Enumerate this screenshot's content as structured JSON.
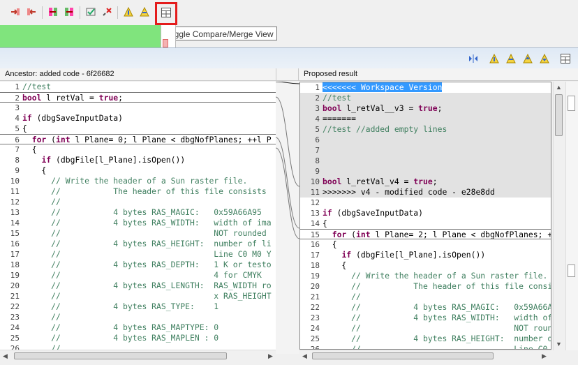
{
  "toolbar": {
    "icons": [
      "copy-all-left-icon",
      "copy-all-right-icon",
      "merge-left-icon",
      "merge-right-icon",
      "accept-icon",
      "reject-icon",
      "next-diff-icon",
      "prev-diff-icon",
      "toggle-compare-view-icon"
    ]
  },
  "tooltip": "Toggle Compare/Merge View",
  "left": {
    "header": "Ancestor: added code - 6f26682",
    "lines": [
      {
        "n": "1",
        "t": "//test"
      },
      {
        "n": "2",
        "t": "bool l_retVal = true;"
      },
      {
        "n": "3",
        "t": ""
      },
      {
        "n": "4",
        "t": "if (dbgSaveInputData)"
      },
      {
        "n": "5",
        "t": "{"
      },
      {
        "n": "6",
        "t": "  for (int l_Plane= 0; l_Plane < dbgNofPlanes; ++l_P"
      },
      {
        "n": "7",
        "t": "  {"
      },
      {
        "n": "8",
        "t": "    if (dbgFile[l_Plane].isOpen())"
      },
      {
        "n": "9",
        "t": "    {"
      },
      {
        "n": "10",
        "t": "      // Write the header of a Sun raster file."
      },
      {
        "n": "11",
        "t": "      //           The header of this file consists"
      },
      {
        "n": "12",
        "t": "      //"
      },
      {
        "n": "13",
        "t": "      //           4 bytes RAS_MAGIC:   0x59A66A95"
      },
      {
        "n": "14",
        "t": "      //           4 bytes RAS_WIDTH:   width of ima"
      },
      {
        "n": "15",
        "t": "      //                                NOT rounded"
      },
      {
        "n": "16",
        "t": "      //           4 bytes RAS_HEIGHT:  number of li"
      },
      {
        "n": "17",
        "t": "      //                                Line C0 M0 Y"
      },
      {
        "n": "18",
        "t": "      //           4 bytes RAS_DEPTH:   1 K or testo"
      },
      {
        "n": "19",
        "t": "      //                                4 for CMYK"
      },
      {
        "n": "20",
        "t": "      //           4 bytes RAS_LENGTH:  RAS_WIDTH ro"
      },
      {
        "n": "21",
        "t": "      //                                x RAS_HEIGHT"
      },
      {
        "n": "22",
        "t": "      //           4 bytes RAS_TYPE:    1"
      },
      {
        "n": "23",
        "t": "      //"
      },
      {
        "n": "24",
        "t": "      //           4 bytes RAS_MAPTYPE: 0"
      },
      {
        "n": "25",
        "t": "      //           4 bytes RAS_MAPLEN : 0"
      },
      {
        "n": "26",
        "t": "      //"
      }
    ]
  },
  "right": {
    "header": "Proposed result",
    "lines": [
      {
        "n": "1",
        "t": "<<<<<<< Workspace Version"
      },
      {
        "n": "2",
        "t": "//test"
      },
      {
        "n": "3",
        "t": "bool l_retVal__v3 = true;"
      },
      {
        "n": "4",
        "t": "======="
      },
      {
        "n": "5",
        "t": "//test //added empty lines"
      },
      {
        "n": "6",
        "t": ""
      },
      {
        "n": "7",
        "t": ""
      },
      {
        "n": "8",
        "t": ""
      },
      {
        "n": "9",
        "t": ""
      },
      {
        "n": "10",
        "t": "bool l_retVal_v4 = true;"
      },
      {
        "n": "11",
        "t": ">>>>>>> v4 - modified code - e28e8dd"
      },
      {
        "n": "12",
        "t": ""
      },
      {
        "n": "13",
        "t": "if (dbgSaveInputData)"
      },
      {
        "n": "14",
        "t": "{"
      },
      {
        "n": "15",
        "t": "  for (int l_Plane= 2; l_Plane < dbgNofPlanes; +"
      },
      {
        "n": "16",
        "t": "  {"
      },
      {
        "n": "17",
        "t": "    if (dbgFile[l_Plane].isOpen())"
      },
      {
        "n": "18",
        "t": "    {"
      },
      {
        "n": "19",
        "t": "      // Write the header of a Sun raster file."
      },
      {
        "n": "20",
        "t": "      //           The header of this file consi"
      },
      {
        "n": "21",
        "t": "      //"
      },
      {
        "n": "22",
        "t": "      //           4 bytes RAS_MAGIC:   0x59A66A"
      },
      {
        "n": "23",
        "t": "      //           4 bytes RAS_WIDTH:   width of"
      },
      {
        "n": "24",
        "t": "      //                                NOT roun"
      },
      {
        "n": "25",
        "t": "      //           4 bytes RAS_HEIGHT:  number o"
      },
      {
        "n": "26",
        "t": "      //                                Line C0"
      }
    ]
  },
  "colors": {
    "accent": "#3399ff",
    "highlight_box": "#e41c1c",
    "green_bar": "#80e47d",
    "keyword": "#7f0055",
    "comment": "#3f7f5f"
  }
}
